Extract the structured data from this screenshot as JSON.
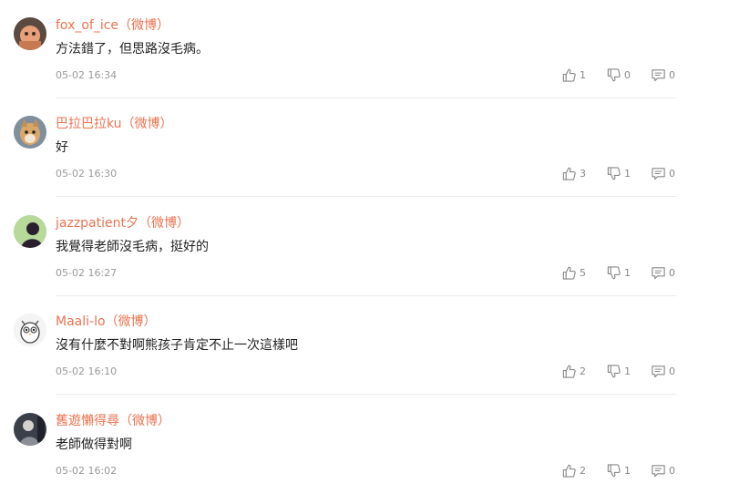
{
  "comments": [
    {
      "username": "fox_of_ice（微博）",
      "text": "方法錯了，但思路沒毛病。",
      "time": "05-02 16:34",
      "likes": "1",
      "dislikes": "0",
      "replies": "0",
      "avatar": "avatar-fox"
    },
    {
      "username": "巴拉巴拉ku（微博）",
      "text": "好",
      "time": "05-02 16:30",
      "likes": "3",
      "dislikes": "1",
      "replies": "0",
      "avatar": "avatar-dog"
    },
    {
      "username": "jazzpatient夕（微博）",
      "text": "我覺得老師沒毛病，挺好的",
      "time": "05-02 16:27",
      "likes": "5",
      "dislikes": "1",
      "replies": "0",
      "avatar": "avatar-silhouette"
    },
    {
      "username": "Maali-lo（微博）",
      "text": "沒有什麼不對啊熊孩子肯定不止一次這樣吧",
      "time": "05-02 16:10",
      "likes": "2",
      "dislikes": "1",
      "replies": "0",
      "avatar": "avatar-owl"
    },
    {
      "username": "舊遊懶得尋（微博）",
      "text": "老師做得對啊",
      "time": "05-02 16:02",
      "likes": "2",
      "dislikes": "1",
      "replies": "0",
      "avatar": "avatar-dark"
    }
  ],
  "icons": {
    "like": "thumbs-up-icon",
    "dislike": "thumbs-down-icon",
    "reply": "comment-bubble-icon"
  },
  "colors": {
    "username": "#eb7350",
    "text": "#222222",
    "meta": "#999999"
  }
}
